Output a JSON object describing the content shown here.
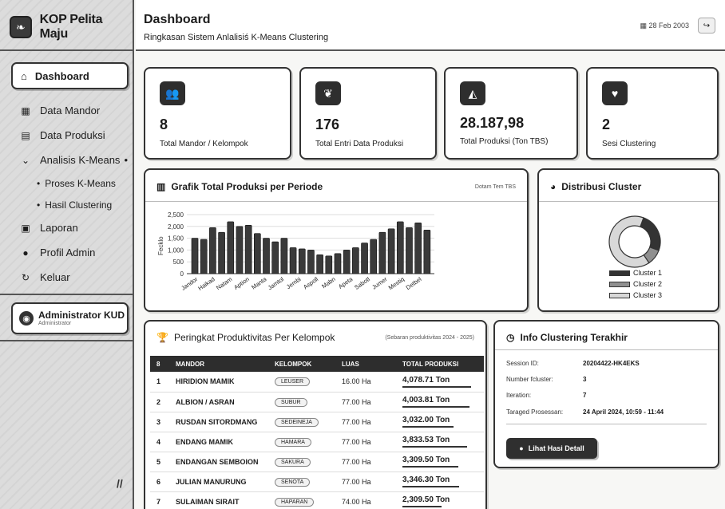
{
  "brand": {
    "name": "KOP Pelita Maju"
  },
  "sidebar": {
    "active": "Dashboard",
    "items": [
      {
        "label": "Data Mandor"
      },
      {
        "label": "Data Produksi"
      },
      {
        "label": "Analisis K-Means"
      },
      {
        "label": "Laporan"
      },
      {
        "label": "Profil Admin"
      },
      {
        "label": "Keluar"
      }
    ],
    "sub_items": [
      "Proses K-Means",
      "Hasil Clustering"
    ],
    "admin": {
      "name": "Administrator KUD",
      "role": "Administrator"
    },
    "footer": "//"
  },
  "header": {
    "title": "Dashboard",
    "subtitle": "Ringkasan Sistem Anlalisiś K-Means Clustering",
    "date": "28 Feb 2003"
  },
  "stats": [
    {
      "value": "8",
      "label": "Total Mandor / Kelompok",
      "icon": "users-icon"
    },
    {
      "value": "176",
      "label": "Total Entri Data Produksi",
      "icon": "leaf-icon"
    },
    {
      "value": "28.187,98",
      "label": "Total Produksi (Ton TBS)",
      "icon": "bell-icon"
    },
    {
      "value": "2",
      "label": "Sesi Clustering",
      "icon": "heart-icon"
    }
  ],
  "production_chart": {
    "title": "Grafik Total Produksi per Periode",
    "note": "Dotam Tem TBS"
  },
  "cluster_chart": {
    "title": "Distribusi Cluster"
  },
  "chart_data": [
    {
      "type": "bar",
      "title": "Grafik Total Produksi per Periode",
      "ylabel": "Fecklo",
      "ylim": [
        0,
        2500
      ],
      "yticks": [
        "2,500",
        "2,000",
        "1,500",
        "1,000",
        "500",
        "0"
      ],
      "grid": true,
      "categories": [
        "Jandor",
        "Haikad",
        "Natam",
        "Aption",
        "Manta",
        "Jamtol",
        "Jembi",
        "Aspoll",
        "Mabn",
        "Apeta",
        "Sabotl",
        "Jumer",
        "Mestiq",
        "Detbel"
      ],
      "values": [
        1500,
        1450,
        1950,
        1750,
        2200,
        2000,
        2050,
        1700,
        1500,
        1350,
        1500,
        1100,
        1050,
        1000,
        800,
        750,
        850,
        1000,
        1100,
        1300,
        1450,
        1750,
        1900,
        2200,
        1950,
        2150,
        1850
      ]
    },
    {
      "type": "pie",
      "title": "Distribusi Cluster",
      "labels": [
        "Cluster 1",
        "Cluster 2",
        "Cluster 3"
      ],
      "values": [
        25,
        10,
        65
      ],
      "colors": [
        "#333333",
        "#8f8f8f",
        "#d8d8d8"
      ]
    }
  ],
  "ranking": {
    "title": "Peringkat Produktivitas Per Kelompok",
    "note": "(Sebaran produktivitas 2024 - 2025)",
    "columns": [
      "8",
      "MANDOR",
      "KELOMPOK",
      "LUAS",
      "TOTAL PRODUKSI"
    ],
    "rows": [
      {
        "no": "1",
        "mandor": "HIRIDION MAMIK",
        "kelompok": "LEUSER",
        "luas": "16.00 Ha",
        "total": "4,078.71 Ton",
        "bar": 1.0
      },
      {
        "no": "2",
        "mandor": "ALBION / ASRAN",
        "kelompok": "SUBUR",
        "luas": "77.00 Ha",
        "total": "4,003.81 Ton",
        "bar": 0.98
      },
      {
        "no": "3",
        "mandor": "RUSDAN SITORDMANG",
        "kelompok": "SEDEINEJA",
        "luas": "77.00 Ha",
        "total": "3,032.00 Ton",
        "bar": 0.74
      },
      {
        "no": "4",
        "mandor": "ENDANG MAMIK",
        "kelompok": "HAMARA",
        "luas": "77.00 Ha",
        "total": "3,833.53 Ton",
        "bar": 0.94
      },
      {
        "no": "5",
        "mandor": "ENDANGAN SEMBOION",
        "kelompok": "SAKURA",
        "luas": "77.00 Ha",
        "total": "3,309.50 Ton",
        "bar": 0.81
      },
      {
        "no": "6",
        "mandor": "JULIAN MANURUNG",
        "kelompok": "SENOTA",
        "luas": "77.00 Ha",
        "total": "3,346.30 Ton",
        "bar": 0.82
      },
      {
        "no": "7",
        "mandor": "SULAIMAN SIRAIT",
        "kelompok": "HAPARAN",
        "luas": "74.00 Ha",
        "total": "2,309.50 Ton",
        "bar": 0.57
      }
    ]
  },
  "info": {
    "title": "Info Clustering Terakhir",
    "rows": [
      {
        "k": "Session ID:",
        "v": "20204422-HK4EKS"
      },
      {
        "k": "Number fcluster:",
        "v": "3"
      },
      {
        "k": "Iteration:",
        "v": "7"
      },
      {
        "k": "Taraged Prosessan:",
        "v": "24 April 2024, 10:59 - 11:44"
      }
    ],
    "button": "Lihat Hasi Detall"
  }
}
